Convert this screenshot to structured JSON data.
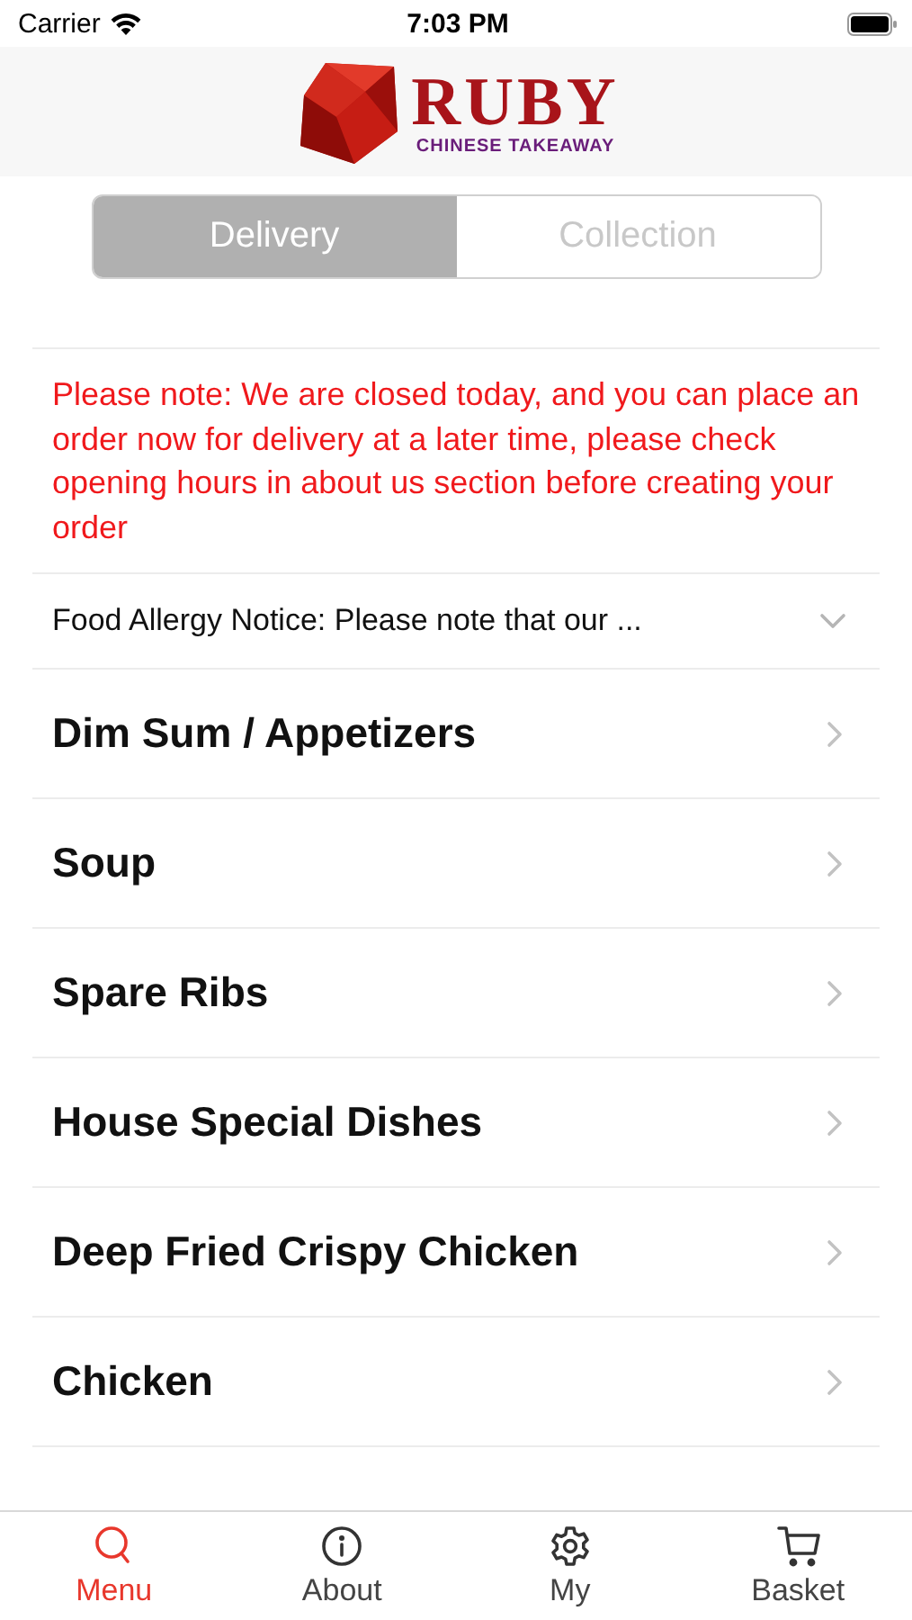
{
  "status_bar": {
    "carrier": "Carrier",
    "time": "7:03 PM"
  },
  "header": {
    "logo_title": "RUBY",
    "logo_subtitle": "CHINESE TAKEAWAY"
  },
  "order_type": [
    {
      "label": "Delivery",
      "selected": true
    },
    {
      "label": "Collection",
      "selected": false
    }
  ],
  "notice": "Please note: We are closed today, and you can place an order now for delivery at a later time, please check opening hours in about us section before creating your order",
  "allergy_notice": {
    "text": "Food Allergy Notice: Please note that our ...",
    "expanded": false
  },
  "categories": [
    {
      "name": "Dim Sum / Appetizers"
    },
    {
      "name": "Soup"
    },
    {
      "name": "Spare Ribs"
    },
    {
      "name": "House Special Dishes"
    },
    {
      "name": "Deep Fried Crispy Chicken"
    },
    {
      "name": "Chicken"
    }
  ],
  "tab_bar": [
    {
      "kind": "search",
      "label": "Menu",
      "selected": true
    },
    {
      "kind": "info",
      "label": "About",
      "selected": false
    },
    {
      "kind": "gear",
      "label": "My",
      "selected": false
    },
    {
      "kind": "cart",
      "label": "Basket",
      "selected": false
    }
  ]
}
